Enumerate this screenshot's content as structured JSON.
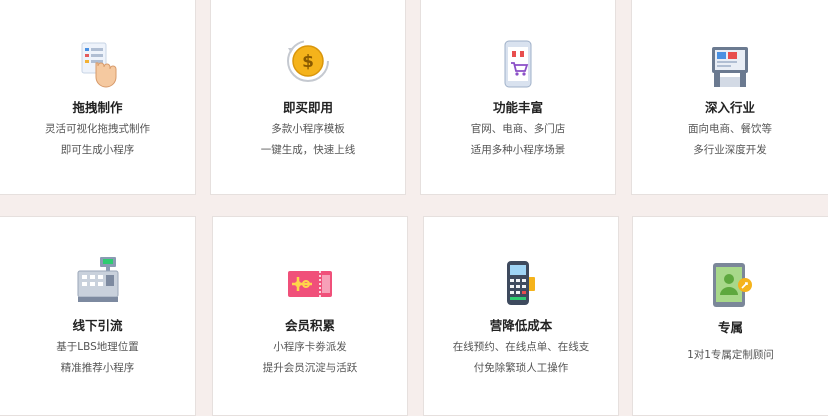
{
  "features": [
    {
      "title": "拖拽制作",
      "lines": [
        "灵活可视化拖拽式制作",
        "即可生成小程序"
      ],
      "icon": "drag-hand-icon"
    },
    {
      "title": "即买即用",
      "lines": [
        "多款小程序模板",
        "一键生成，快速上线"
      ],
      "icon": "dollar-coin-icon"
    },
    {
      "title": "功能丰富",
      "lines": [
        "官网、电商、多门店",
        "适用多种小程序场景"
      ],
      "icon": "phone-shop-icon"
    },
    {
      "title": "深入行业",
      "lines": [
        "面向电商、餐饮等",
        "多行业深度开发"
      ],
      "icon": "industry-screen-icon"
    },
    {
      "title": "线下引流",
      "lines": [
        "基于LBS地理位置",
        "精准推荐小程序"
      ],
      "icon": "cash-register-icon"
    },
    {
      "title": "会员积累",
      "lines": [
        "小程序卡劵派发",
        "提升会员沉淀与活跃"
      ],
      "icon": "gift-card-icon"
    },
    {
      "title": "营降低成本",
      "lines": [
        "在线预约、在线点单、在线支",
        "付免除繁琐人工操作"
      ],
      "icon": "pos-terminal-icon"
    },
    {
      "title": "专属",
      "lines": [
        "1对1专属定制顾问"
      ],
      "icon": "consultant-tablet-icon"
    }
  ]
}
